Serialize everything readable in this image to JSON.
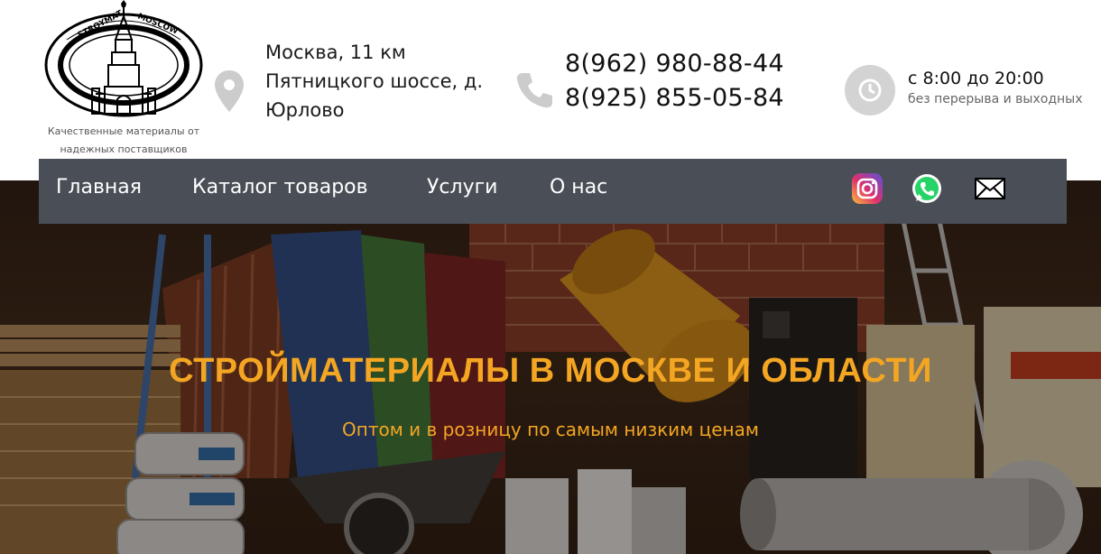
{
  "header": {
    "logo": {
      "emblem_text_left": "STROYMAT",
      "emblem_text_right": "MOSCOW",
      "tagline": "Качественные материалы от надежных поставщиков"
    },
    "address": {
      "icon": "map-pin-icon",
      "text": "Москва, 11 км Пятницкого шоссе, д. Юрлово"
    },
    "phones": {
      "icon": "phone-icon",
      "numbers": [
        "8(962) 980-88-44",
        "8(925) 855-05-84"
      ]
    },
    "hours": {
      "icon": "clock-icon",
      "main": "с 8:00 до 20:00",
      "sub": "без перерыва и выходных"
    }
  },
  "nav": {
    "items": [
      "Главная",
      "Каталог товаров",
      "Услуги",
      "О нас"
    ],
    "social": [
      {
        "name": "instagram-icon"
      },
      {
        "name": "whatsapp-icon"
      },
      {
        "name": "email-icon"
      }
    ]
  },
  "hero": {
    "title": "СТРОЙМАТЕРИАЛЫ В МОСКВЕ И ОБЛАСТИ",
    "subtitle": "Оптом и в розницу по самым низким ценам"
  },
  "colors": {
    "nav_bg": "#4a4f57",
    "accent": "#f4a623",
    "icon_gray": "#cccccc"
  }
}
